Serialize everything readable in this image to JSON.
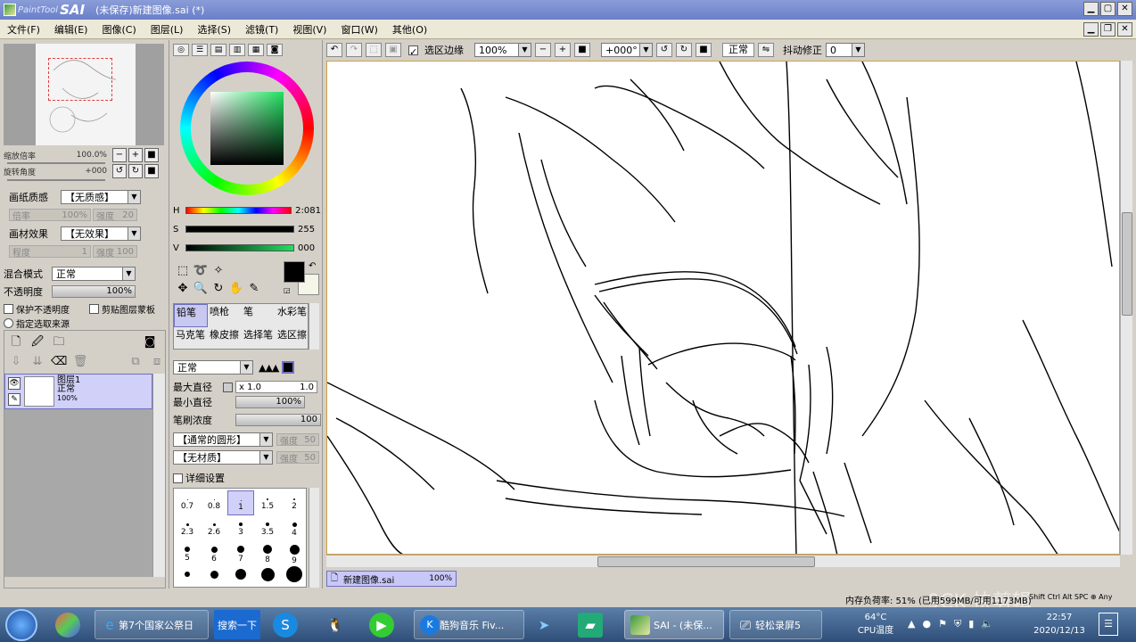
{
  "titlebar": {
    "logo_small": "PaintTool",
    "logo_big": "SAI",
    "title": "(未保存)新建图像.sai (*)"
  },
  "menu": [
    "文件(F)",
    "编辑(E)",
    "图像(C)",
    "图层(L)",
    "选择(S)",
    "滤镜(T)",
    "视图(V)",
    "窗口(W)",
    "其他(O)"
  ],
  "navigator": {
    "zoom_label": "缩放倍率",
    "zoom_value": "100.0%",
    "rotate_label": "旋转角度",
    "rotate_value": "+000"
  },
  "paper": {
    "texture_label": "画纸质感",
    "texture_value": "【无质感】",
    "scale_label": "倍率",
    "scale_value": "100%",
    "strength_label": "强度",
    "strength_value": "20",
    "effect_label": "画材效果",
    "effect_value": "【无效果】",
    "degree_label": "程度",
    "degree_value": "1",
    "strength2_label": "强度",
    "strength2_value": "100"
  },
  "layer_props": {
    "blend_label": "混合模式",
    "blend_value": "正常",
    "opacity_label": "不透明度",
    "opacity_value": "100%",
    "protect_opacity": "保护不透明度",
    "clip_mask": "剪贴图层蒙板",
    "selection_source": "指定选取来源"
  },
  "layer": {
    "name": "图层1",
    "mode": "正常",
    "opacity": "100%"
  },
  "color": {
    "h_label": "H",
    "h_value": "2:081",
    "s_label": "S",
    "s_value": "255",
    "v_label": "V",
    "v_value": "000",
    "main": "#000000",
    "sub": "#f5f5e8"
  },
  "brushes": [
    {
      "name": "铅笔",
      "selected": true
    },
    {
      "name": "喷枪",
      "selected": false
    },
    {
      "name": "笔",
      "selected": false
    },
    {
      "name": "水彩笔",
      "selected": false
    },
    {
      "name": "马克笔",
      "selected": false
    },
    {
      "name": "橡皮擦",
      "selected": false
    },
    {
      "name": "选择笔",
      "selected": false
    },
    {
      "name": "选区擦",
      "selected": false
    }
  ],
  "brush_settings": {
    "mode": "正常",
    "max_size_label": "最大直径",
    "max_size_mult": "x 1.0",
    "max_size_value": "1.0",
    "min_size_label": "最小直径",
    "min_size_value": "100%",
    "density_label": "笔刷浓度",
    "density_value": "100",
    "shape": "【通常的圆形】",
    "shape_strength_label": "强度",
    "shape_strength": "50",
    "texture": "【无材质】",
    "texture_strength_label": "强度",
    "texture_strength": "50",
    "details": "详细设置"
  },
  "sizes": [
    "0.7",
    "0.8",
    "1",
    "1.5",
    "2",
    "2.3",
    "2.6",
    "3",
    "3.5",
    "4",
    "5",
    "6",
    "7",
    "8",
    "9"
  ],
  "selected_size": "1",
  "canvas_toolbar": {
    "sel_edge": "选区边缘",
    "zoom": "100%",
    "angle": "+000°",
    "mode": "正常",
    "stabilizer_label": "抖动修正",
    "stabilizer_value": "0"
  },
  "doc_tab": {
    "name": "新建图像.sai",
    "zoom": "100%"
  },
  "status": {
    "memory": "内存负荷率: 51% (已用599MB/可用1173MB)",
    "keys": "Shift Ctrl Alt SPC ⊕ Any",
    "watermark": "9CK 快剪辑"
  },
  "taskbar": {
    "apps": [
      {
        "label": "第7个国家公祭日",
        "icon": "ie-icon"
      },
      {
        "label": "搜索一下",
        "icon": "search-icon"
      },
      {
        "label": "酷狗音乐 Fiv...",
        "icon": "kugou-icon"
      },
      {
        "label": "SAI - (未保...",
        "icon": "sai-icon"
      },
      {
        "label": "轻松录屏5",
        "icon": "recorder-icon"
      }
    ],
    "cpu_temp": "64°C",
    "cpu_label": "CPU温度",
    "time": "22:57",
    "date": "2020/12/13"
  }
}
